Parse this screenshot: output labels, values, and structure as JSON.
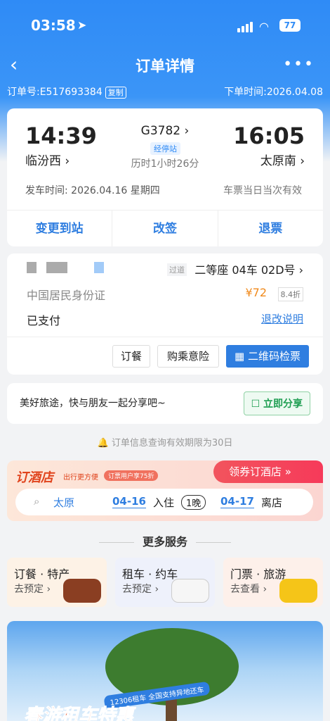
{
  "status": {
    "time": "03:58",
    "battery": "77"
  },
  "nav": {
    "title": "订单详情"
  },
  "order": {
    "number": "订单号:E517693384",
    "copy": "复制",
    "time": "下单时间:2026.04.08"
  },
  "trip": {
    "dep_time": "14:39",
    "dep_station": "临汾西 ›",
    "arr_time": "16:05",
    "arr_station": "太原南 ›",
    "train": "G3782 ›",
    "stop_tag": "经停站",
    "duration": "历时1小时26分",
    "go_date": "发车时间:  2026.04.16  星期四",
    "validity": "车票当日当次有效",
    "actions": [
      "变更到站",
      "改签",
      "退票"
    ]
  },
  "passenger": {
    "tag": "过道",
    "seat": "二等座 04车 02D号 ›",
    "id_type": "中国居民身份证",
    "price": "¥72",
    "discount": "8.4折",
    "paid": "已支付",
    "rules": "退改说明",
    "buttons": [
      "订餐",
      "购乘意险",
      "▦ 二维码检票"
    ]
  },
  "share": {
    "text": "美好旅途，快与朋友一起分享吧~",
    "button": "☐ 立即分享"
  },
  "notice": "🔔 订单信息查询有效期限为30日",
  "hotel": {
    "logo": "订酒店",
    "subtitle": "出行更方便",
    "pill": "订票用户享75折",
    "button": "领券订酒店  »",
    "city": "太原",
    "date_in": "04-16",
    "in_label": "入住",
    "nights": "1晚",
    "date_out": "04-17",
    "out_label": "离店"
  },
  "more": {
    "title": "更多服务"
  },
  "services": [
    {
      "name": "订餐 · 特产",
      "action": "去预定 ›"
    },
    {
      "name": "租车 · 约车",
      "action": "去预定 ›"
    },
    {
      "name": "门票 · 旅游",
      "action": "去查看 ›"
    }
  ],
  "banner": {
    "pill": "12306租车 全国支持异地还车",
    "title": "春游租车特惠"
  }
}
